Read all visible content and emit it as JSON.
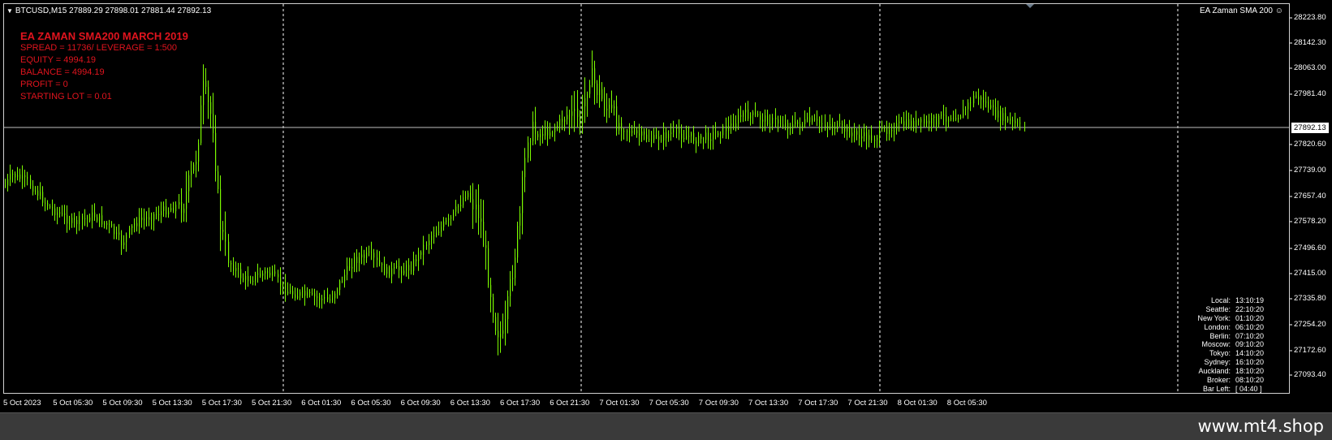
{
  "chart": {
    "title": "BTCUSD,M15  27889.29 27898.01 27881.44 27892.13",
    "ea_name": "EA Zaman SMA 200",
    "current_price": "27892.13",
    "price_axis": [
      "28223.80",
      "28142.30",
      "28063.00",
      "27981.40",
      "27820.60",
      "27739.00",
      "27657.40",
      "27578.20",
      "27496.60",
      "27415.00",
      "27335.80",
      "27254.20",
      "27172.60",
      "27093.40"
    ],
    "time_axis": [
      "5 Oct 2023",
      "5 Oct 05:30",
      "5 Oct 09:30",
      "5 Oct 13:30",
      "5 Oct 17:30",
      "5 Oct 21:30",
      "6 Oct 01:30",
      "6 Oct 05:30",
      "6 Oct 09:30",
      "6 Oct 13:30",
      "6 Oct 17:30",
      "6 Oct 21:30",
      "7 Oct 01:30",
      "7 Oct 05:30",
      "7 Oct 09:30",
      "7 Oct 13:30",
      "7 Oct 17:30",
      "7 Oct 21:30",
      "8 Oct 01:30",
      "8 Oct 05:30"
    ],
    "colors": {
      "candle": "#7CFC00",
      "text": "#ffffff",
      "info": "#e0141e",
      "background": "#000000"
    }
  },
  "info_box": {
    "heading": "EA ZAMAN SMA200 MARCH 2019",
    "spread": "SPREAD = 11736/ LEVERAGE = 1:500",
    "equity": "EQUITY = 4994.19",
    "balance": "BALANCE = 4994.19",
    "profit": "PROFIT = 0",
    "starting_lot": "STARTING LOT = 0.01"
  },
  "clock": [
    {
      "city": "Local:",
      "time": "13:10:19"
    },
    {
      "city": "Seattle:",
      "time": "22:10:20"
    },
    {
      "city": "New York:",
      "time": "01:10:20"
    },
    {
      "city": "London:",
      "time": "06:10:20"
    },
    {
      "city": "Berlin:",
      "time": "07:10:20"
    },
    {
      "city": "Moscow:",
      "time": "09:10:20"
    },
    {
      "city": "Tokyo:",
      "time": "14:10:20"
    },
    {
      "city": "Sydney:",
      "time": "16:10:20"
    },
    {
      "city": "Auckland:",
      "time": "18:10:20"
    },
    {
      "city": "Broker:",
      "time": "08:10:20"
    },
    {
      "city": "Bar Left:",
      "time": "[ 04:40 ]"
    }
  ],
  "footer": {
    "watermark": "www.mt4.shop"
  }
}
